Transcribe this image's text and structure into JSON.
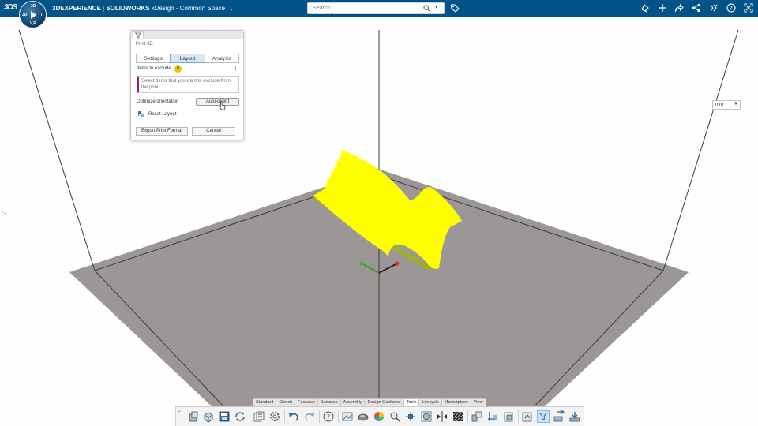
{
  "header": {
    "brand_prefix": "3DEXPERIENCE",
    "brand_main": "SOLIDWORKS",
    "app_name": "xDesign - Common Space",
    "ds_logo": "3DS",
    "compass_labels": {
      "top": "3D",
      "left": "3D",
      "right": "I",
      "bottom": "V,R"
    },
    "search": {
      "placeholder": "Search",
      "value": ""
    },
    "icons": [
      "tag-icon",
      "notify-icon",
      "add-icon",
      "share-arrow-icon",
      "share-network-icon",
      "apps-icon",
      "help-icon",
      "fullscreen-icon"
    ],
    "bg_color": "#005386"
  },
  "print_panel": {
    "title": "Print 3D",
    "tabs": [
      {
        "label": "Settings",
        "active": false
      },
      {
        "label": "Layout",
        "active": true
      },
      {
        "label": "Analysis",
        "active": false
      }
    ],
    "exclude_label": "Items to exclude",
    "exclude_count": "0",
    "exclude_placeholder": "Select items that you want to exclude from the print.",
    "orient_label": "Optimize orientation",
    "auto_orient_button": "Auto-orient",
    "reset_label": "Reset Layout",
    "export_button": "Export Print Format",
    "cancel_button": "Cancel",
    "accent_color": "#8e1f84"
  },
  "units": {
    "selected": "mm"
  },
  "action_bar": {
    "tabs": [
      {
        "label": "Standard",
        "active": false
      },
      {
        "label": "Sketch",
        "active": false
      },
      {
        "label": "Features",
        "active": false
      },
      {
        "label": "Surfaces",
        "active": false
      },
      {
        "label": "Assembly",
        "active": false
      },
      {
        "label": "Design Guidance",
        "active": false
      },
      {
        "label": "Tools",
        "active": true
      },
      {
        "label": "Lifecycle",
        "active": false
      },
      {
        "label": "Marketplace",
        "active": false
      },
      {
        "label": "View",
        "active": false
      }
    ],
    "tools": [
      "insert-icon",
      "create-part-icon",
      "save-icon",
      "refresh-icon",
      "properties-icon",
      "settings-icon",
      "undo-icon",
      "redo-icon",
      "help-icon",
      "capture-icon",
      "render-icon",
      "appearance-icon",
      "measure-icon",
      "explode-icon",
      "section-icon",
      "align-icon",
      "hatch-icon",
      "interference-icon",
      "mass-props-icon",
      "bom-icon",
      "publish-icon",
      "print3d-icon",
      "export-icon",
      "download-icon"
    ]
  },
  "scene": {
    "part_color": "#ffff00",
    "bed_color": "#9b9797"
  }
}
